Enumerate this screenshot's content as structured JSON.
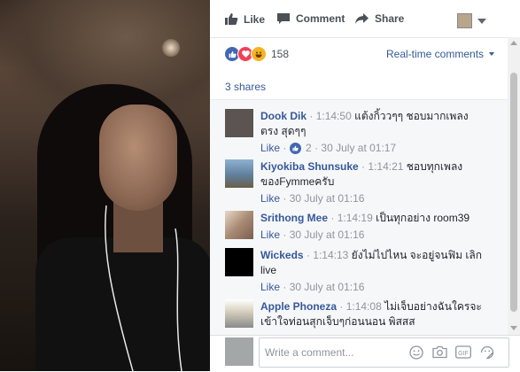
{
  "actions": {
    "like_label": "Like",
    "comment_label": "Comment",
    "share_label": "Share"
  },
  "reactions": {
    "count": "158",
    "types": [
      "like-icon",
      "love-icon",
      "haha-icon"
    ]
  },
  "filter": {
    "label": "Real-time comments"
  },
  "shares": {
    "label": "3 shares"
  },
  "comments": [
    {
      "name": "Dook Dik",
      "time": "1:14:50",
      "text": "แต้งกิ้ววๆๆ ชอบมากเพลงตรง สุดๆๆ",
      "like": "Like",
      "likes_count": "2",
      "date": "30 July at 01:17",
      "avatar_color": "#5b5450"
    },
    {
      "name": "Kiyokiba Shunsuke",
      "time": "1:14:21",
      "text": "ชอบทุกเพลงของFymmeครับ",
      "like": "Like",
      "date": "30 July at 01:16",
      "avatar_color": "#6f8fae"
    },
    {
      "name": "Srithong Mee",
      "time": "1:14:19",
      "text": "เป็นทุกอย่าง room39",
      "like": "Like",
      "date": "30 July at 01:16",
      "avatar_color": "#a98a74"
    },
    {
      "name": "Wickeds",
      "time": "1:14:13",
      "text": "ยังไม่ไปไหน จะอยู่จนฟิม เลิก live",
      "like": "Like",
      "date": "30 July at 01:16",
      "avatar_color": "#000000"
    },
    {
      "name": "Apple Phoneza",
      "time": "1:14:08",
      "text": "ไม่เจ็บอย่างฉันใครจะเข้าใจท่อนสุกเจ็บๆก่อนนอน พิสสส",
      "avatar_color": "#d9d2c0"
    }
  ],
  "composer": {
    "placeholder": "Write a comment..."
  }
}
